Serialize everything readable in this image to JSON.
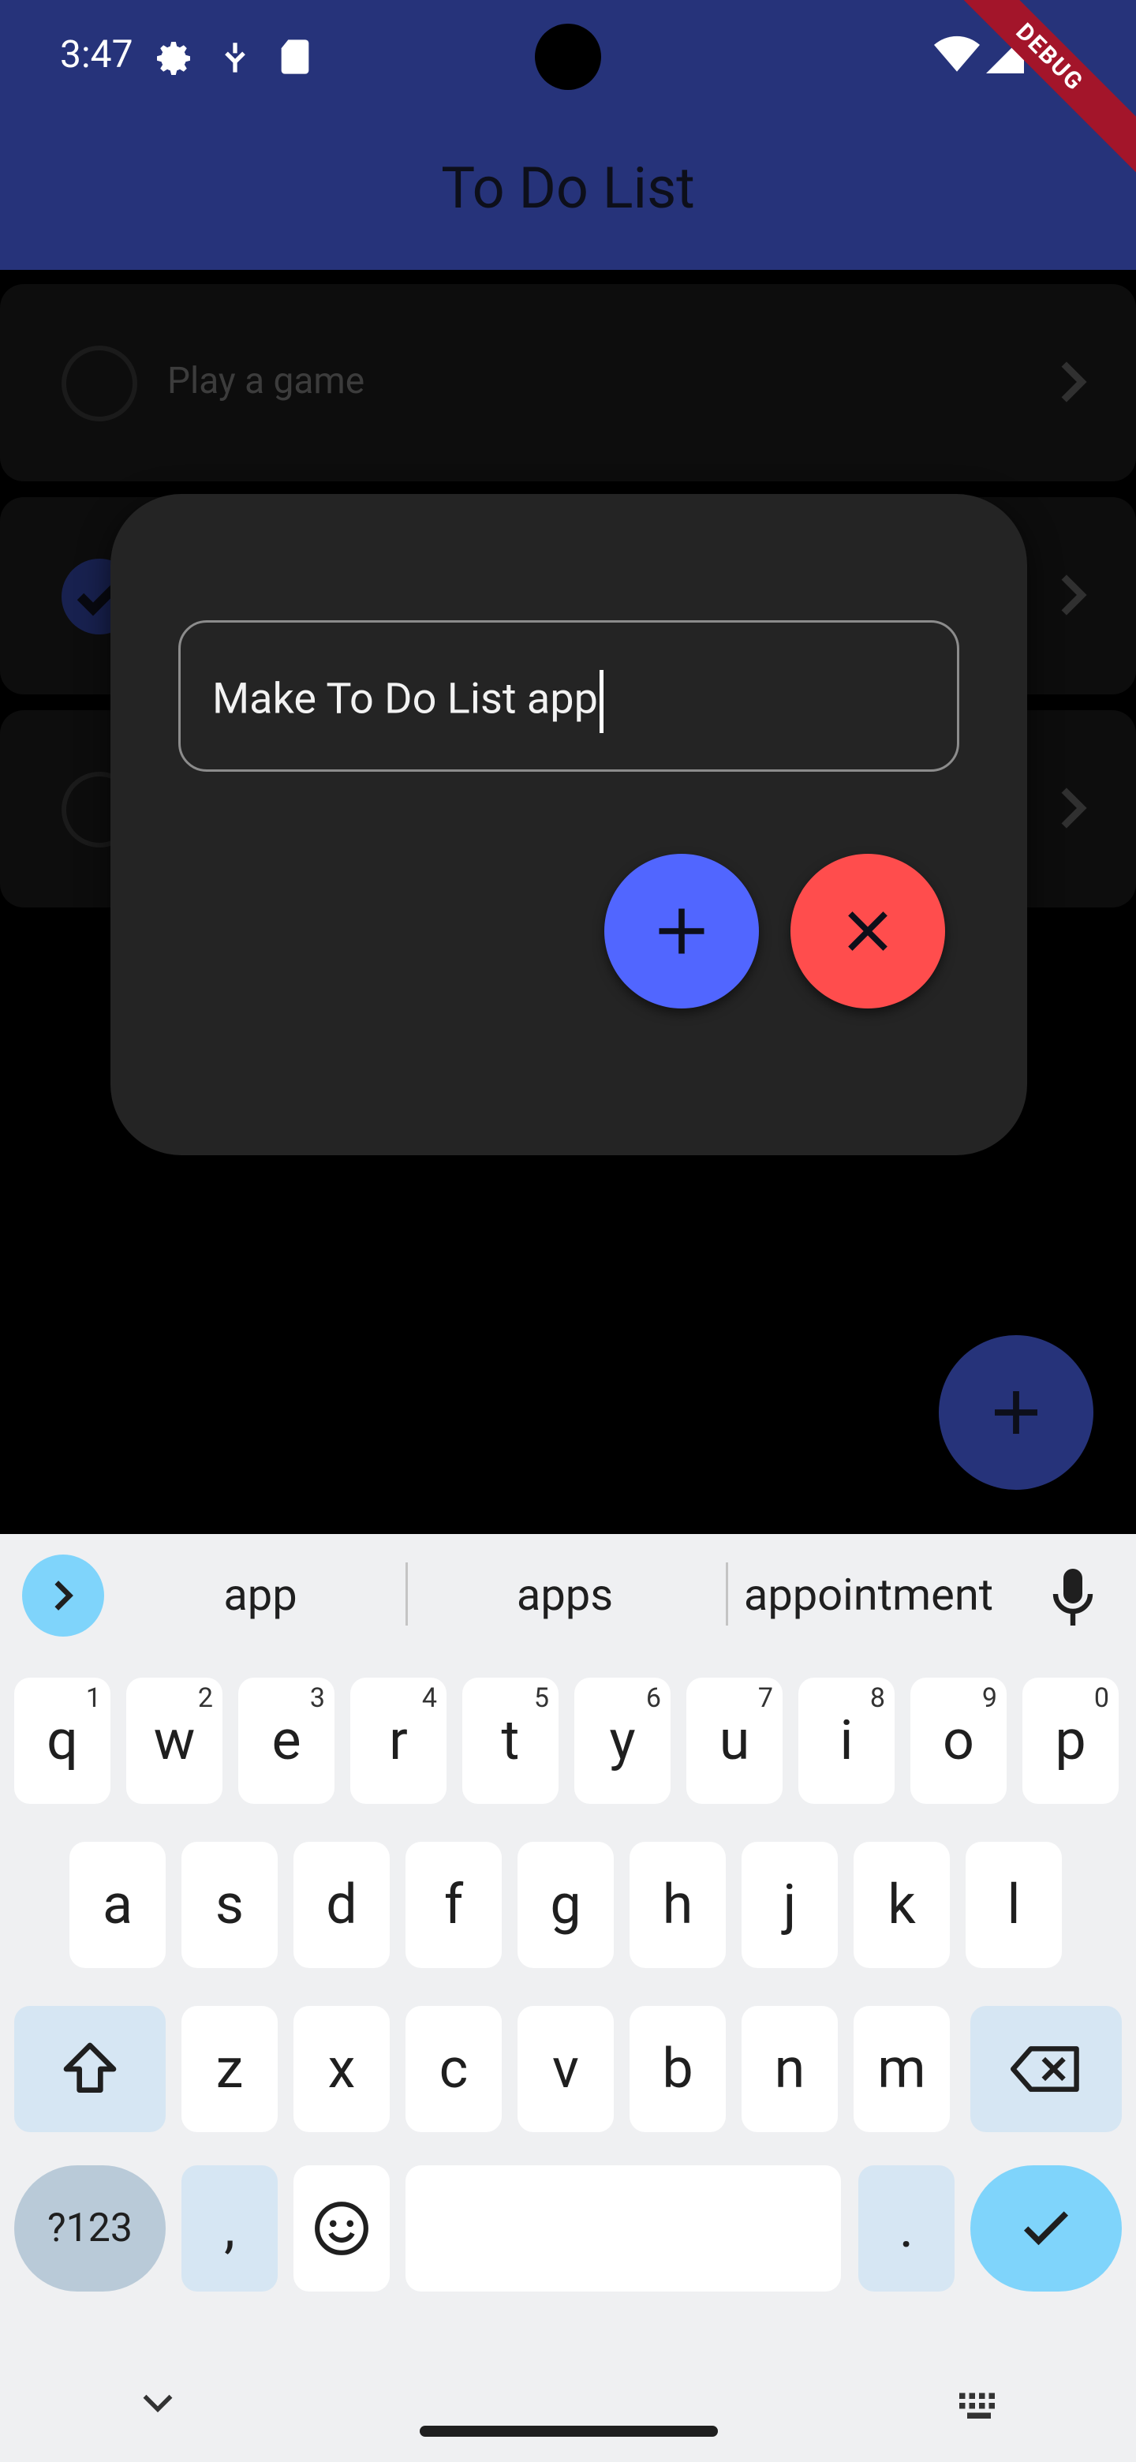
{
  "status_bar": {
    "time": "3:47",
    "icons": [
      "settings-icon",
      "usb-debug-icon",
      "sd-card-icon",
      "wifi-icon",
      "signal-icon"
    ],
    "debug_banner": "DEBUG"
  },
  "app_bar": {
    "title": "To Do List",
    "color": "#26337a"
  },
  "todos": [
    {
      "label": "Play a game",
      "checked": false
    },
    {
      "label": "",
      "checked": true
    },
    {
      "label": "",
      "checked": false
    }
  ],
  "dialog": {
    "input_value": "Make To Do List app",
    "add_button_icon": "plus-icon",
    "cancel_button_icon": "close-icon",
    "add_color": "#5166ff",
    "cancel_color": "#ff4d4d"
  },
  "fab": {
    "icon": "plus-icon"
  },
  "keyboard": {
    "suggestions": [
      "app",
      "apps",
      "appointment"
    ],
    "row1": [
      "q",
      "w",
      "e",
      "r",
      "t",
      "y",
      "u",
      "i",
      "o",
      "p"
    ],
    "row1_hints": [
      "1",
      "2",
      "3",
      "4",
      "5",
      "6",
      "7",
      "8",
      "9",
      "0"
    ],
    "row2": [
      "a",
      "s",
      "d",
      "f",
      "g",
      "h",
      "j",
      "k",
      "l"
    ],
    "row3": [
      "z",
      "x",
      "c",
      "v",
      "b",
      "n",
      "m"
    ],
    "symbols_label": "?123",
    "comma": ",",
    "period": "."
  }
}
